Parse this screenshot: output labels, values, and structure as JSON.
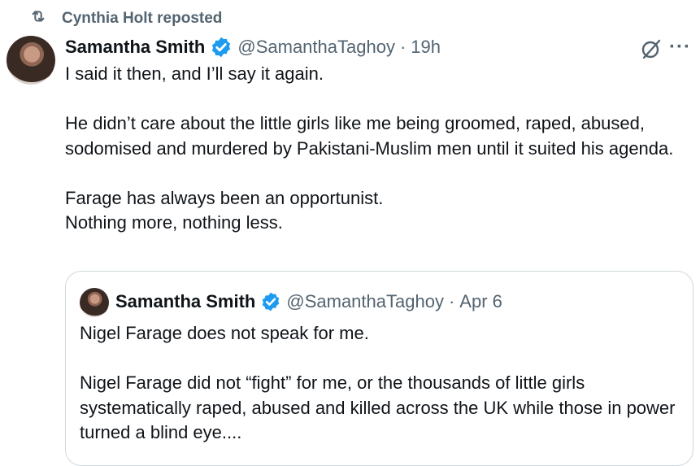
{
  "repost": {
    "label": "Cynthia Holt reposted",
    "icon": "repost-icon"
  },
  "tweet": {
    "author_name": "Samantha Smith",
    "handle": "@SamanthaTaghoy",
    "separator": "·",
    "time": "19h",
    "paragraphs": [
      "I said it then, and I’ll say it again.",
      "He didn’t care about the little girls like me being groomed, raped, abused, sodomised and murdered by Pakistani-Muslim men until it suited his agenda.",
      "Farage has always been an opportunist.",
      "Nothing more, nothing less."
    ],
    "more_label": "···"
  },
  "quote": {
    "author_name": "Samantha Smith",
    "handle": "@SamanthaTaghoy",
    "separator": "·",
    "time": "Apr 6",
    "paragraphs": [
      "Nigel Farage does not speak for me.",
      "Nigel Farage did not “fight” for me, or the thousands of little girls systematically raped, abused and killed across the UK while those in power turned a blind eye...."
    ]
  },
  "colors": {
    "verified": "#1d9bf0",
    "secondary_text": "#536471",
    "border": "#cfd9de"
  }
}
